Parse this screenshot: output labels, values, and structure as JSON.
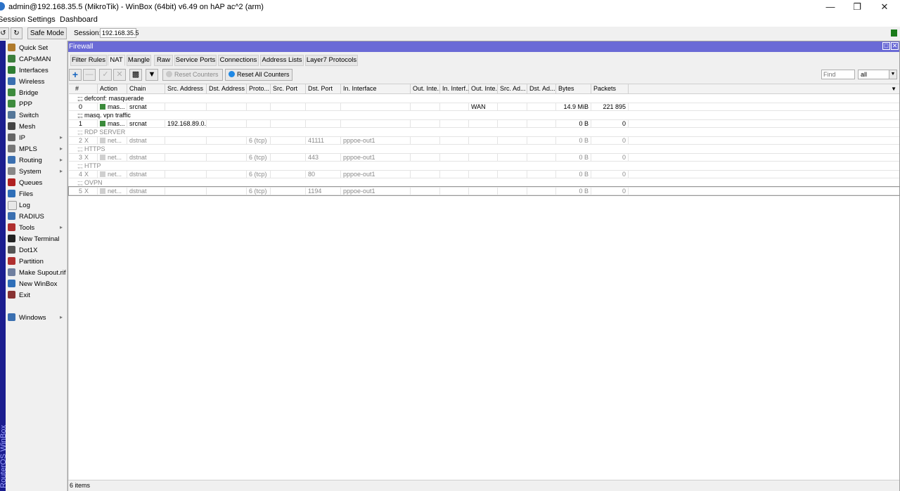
{
  "window": {
    "title": "admin@192.168.35.5 (MikroTik) - WinBox (64bit) v6.49 on hAP ac^2 (arm)"
  },
  "menu": [
    "Session",
    "Settings",
    "Dashboard"
  ],
  "toolbar": {
    "safe_mode": "Safe Mode",
    "session_label": "Session:",
    "session_value": "192.168.35.5"
  },
  "vertical_label": "RouterOS WinBox",
  "sidebar": [
    {
      "label": "Quick Set",
      "icon": "wand-icon",
      "color": "#b07b2c",
      "sub": false
    },
    {
      "label": "CAPsMAN",
      "icon": "antenna-icon",
      "color": "#3c7f3c",
      "sub": false
    },
    {
      "label": "Interfaces",
      "icon": "interfaces-icon",
      "color": "#2e7d32",
      "sub": false
    },
    {
      "label": "Wireless",
      "icon": "wireless-icon",
      "color": "#3a6fb0",
      "sub": false
    },
    {
      "label": "Bridge",
      "icon": "bridge-icon",
      "color": "#3d8b3d",
      "sub": false
    },
    {
      "label": "PPP",
      "icon": "ppp-icon",
      "color": "#3d8b3d",
      "sub": false
    },
    {
      "label": "Switch",
      "icon": "switch-icon",
      "color": "#557799",
      "sub": false
    },
    {
      "label": "Mesh",
      "icon": "mesh-icon",
      "color": "#444444",
      "sub": false
    },
    {
      "label": "IP",
      "icon": "ip-icon",
      "color": "#666666",
      "sub": true
    },
    {
      "label": "MPLS",
      "icon": "mpls-icon",
      "color": "#777777",
      "sub": true
    },
    {
      "label": "Routing",
      "icon": "routing-icon",
      "color": "#3a6fb0",
      "sub": true
    },
    {
      "label": "System",
      "icon": "gear-icon",
      "color": "#888888",
      "sub": true
    },
    {
      "label": "Queues",
      "icon": "queues-icon",
      "color": "#b02020",
      "sub": false
    },
    {
      "label": "Files",
      "icon": "folder-icon",
      "color": "#2f6fb8",
      "sub": false
    },
    {
      "label": "Log",
      "icon": "log-icon",
      "color": "#e8e8e8",
      "sub": false
    },
    {
      "label": "RADIUS",
      "icon": "radius-icon",
      "color": "#3a6fb0",
      "sub": false
    },
    {
      "label": "Tools",
      "icon": "tools-icon",
      "color": "#b03030",
      "sub": true
    },
    {
      "label": "New Terminal",
      "icon": "terminal-icon",
      "color": "#222222",
      "sub": false
    },
    {
      "label": "Dot1X",
      "icon": "dot1x-icon",
      "color": "#555555",
      "sub": false
    },
    {
      "label": "Partition",
      "icon": "partition-icon",
      "color": "#b03030",
      "sub": false
    },
    {
      "label": "Make Supout.rif",
      "icon": "supout-icon",
      "color": "#6f7f9f",
      "sub": false
    },
    {
      "label": "New WinBox",
      "icon": "winbox-icon",
      "color": "#2f6fb8",
      "sub": false
    },
    {
      "label": "Exit",
      "icon": "exit-icon",
      "color": "#883333",
      "sub": false
    },
    {
      "label": "Windows",
      "icon": "windows-icon",
      "color": "#3a6fb0",
      "sub": true
    }
  ],
  "firewall": {
    "title": "Firewall",
    "tabs": [
      "Filter Rules",
      "NAT",
      "Mangle",
      "Raw",
      "Service Ports",
      "Connections",
      "Address Lists",
      "Layer7 Protocols"
    ],
    "active_tab": "NAT",
    "buttons": {
      "reset_counters": "Reset Counters",
      "reset_all_counters": "Reset All Counters"
    },
    "find_placeholder": "Find",
    "filter_value": "all",
    "columns": [
      "#",
      "Action",
      "Chain",
      "Src. Address",
      "Dst. Address",
      "Proto...",
      "Src. Port",
      "Dst. Port",
      "In. Interface",
      "Out. Inte...",
      "In. Interf...",
      "Out. Inte...",
      "Src. Ad...",
      "Dst. Ad...",
      "Bytes",
      "Packets"
    ],
    "rows": [
      {
        "comment": ";;; defconf: masquerade",
        "num": "0",
        "flag": "",
        "action": "mas...",
        "chain": "srcnat",
        "src_address": "",
        "protocol": "",
        "dst_port": "",
        "in_interface": "",
        "out_interface_list": "WAN",
        "bytes": "14.9 MiB",
        "packets": "221 895",
        "disabled": false
      },
      {
        "comment": ";;; masq. vpn traffic",
        "num": "1",
        "flag": "",
        "action": "mas...",
        "chain": "srcnat",
        "src_address": "192.168.89.0...",
        "protocol": "",
        "dst_port": "",
        "in_interface": "",
        "out_interface_list": "",
        "bytes": "0 B",
        "packets": "0",
        "disabled": false
      },
      {
        "comment": ";;; RDP SERVER",
        "num": "2",
        "flag": "X",
        "action": "net...",
        "chain": "dstnat",
        "src_address": "",
        "protocol": "6 (tcp)",
        "dst_port": "41111",
        "in_interface": "pppoe-out1",
        "out_interface_list": "",
        "bytes": "0 B",
        "packets": "0",
        "disabled": true
      },
      {
        "comment": ";;; HTTPS",
        "num": "3",
        "flag": "X",
        "action": "net...",
        "chain": "dstnat",
        "src_address": "",
        "protocol": "6 (tcp)",
        "dst_port": "443",
        "in_interface": "pppoe-out1",
        "out_interface_list": "",
        "bytes": "0 B",
        "packets": "0",
        "disabled": true
      },
      {
        "comment": ";;; HTTP",
        "num": "4",
        "flag": "X",
        "action": "net...",
        "chain": "dstnat",
        "src_address": "",
        "protocol": "6 (tcp)",
        "dst_port": "80",
        "in_interface": "pppoe-out1",
        "out_interface_list": "",
        "bytes": "0 B",
        "packets": "0",
        "disabled": true
      },
      {
        "comment": ";;; OVPN",
        "num": "5",
        "flag": "X",
        "action": "net...",
        "chain": "dstnat",
        "src_address": "",
        "protocol": "6 (tcp)",
        "dst_port": "1194",
        "in_interface": "pppoe-out1",
        "out_interface_list": "",
        "bytes": "0 B",
        "packets": "0",
        "disabled": true
      }
    ],
    "status": "6 items"
  }
}
